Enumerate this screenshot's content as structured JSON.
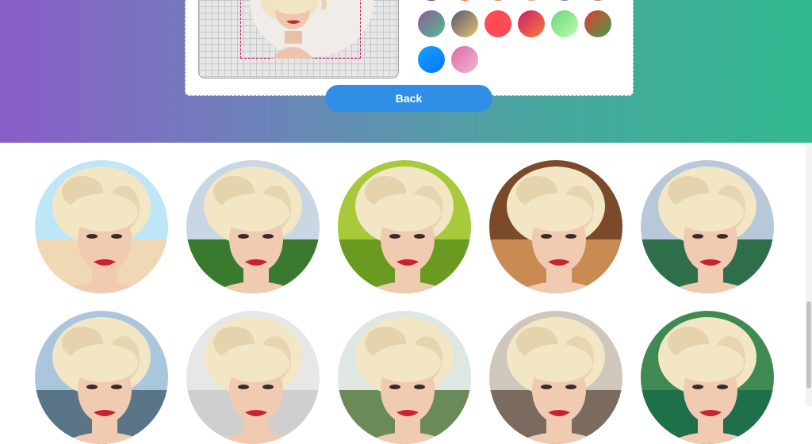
{
  "editor": {
    "back_label": "Back",
    "swatches": [
      {
        "from": "#8e5a9a",
        "to": "#4fbf8e"
      },
      {
        "from": "#555577",
        "to": "#e8c46a"
      },
      {
        "from": "#ff4b55",
        "to": "#ff4b55"
      },
      {
        "from": "#c81e6a",
        "to": "#ff7a3a"
      },
      {
        "from": "#6fd37a",
        "to": "#b8ffb0"
      },
      {
        "from": "#e53935",
        "to": "#43a047"
      },
      {
        "from": "#12a2ff",
        "to": "#0a74ff"
      },
      {
        "from": "#d96aa6",
        "to": "#f4b6d4"
      }
    ],
    "partial_swatches": [
      "#7c3a5a",
      "#ff6a2b",
      "#c89060",
      "#d4a070",
      "#6a7ab0",
      "#a08a6a"
    ]
  },
  "gallery": {
    "avatars": [
      {
        "name": "beach",
        "sky": "#bfe6f7",
        "ground": "#f1d8b4"
      },
      {
        "name": "forest-mountain",
        "sky": "#c9d6e3",
        "ground": "#3a7a2f"
      },
      {
        "name": "green-leaves",
        "sky": "#a8c93a",
        "ground": "#6a9a1f"
      },
      {
        "name": "rock-cave",
        "sky": "#7a4a2a",
        "ground": "#c98b52"
      },
      {
        "name": "mountain-lake",
        "sky": "#b8c8d8",
        "ground": "#2f6e4a"
      },
      {
        "name": "office-window",
        "sky": "#a9c6dd",
        "ground": "#5a7488"
      },
      {
        "name": "white-room",
        "sky": "#e7e7e7",
        "ground": "#cfcfcf"
      },
      {
        "name": "indoor-plant",
        "sky": "#dfe7e3",
        "ground": "#6a8a5a"
      },
      {
        "name": "wood-room",
        "sky": "#cfc6bc",
        "ground": "#7a6b5e"
      },
      {
        "name": "green-waterfall",
        "sky": "#3f8a52",
        "ground": "#1f6f4a"
      }
    ]
  },
  "colors": {
    "skin": "#f0cbb2",
    "hair": "#f2e6c4",
    "hair_shadow": "#d9c29a",
    "lips": "#c9232f",
    "accent": "#2f8fe6"
  }
}
